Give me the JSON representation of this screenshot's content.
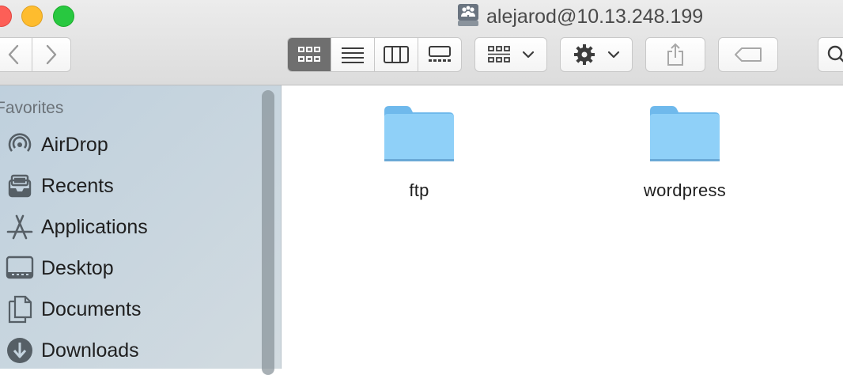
{
  "window": {
    "title": "alejarod@10.13.248.199",
    "title_icon": "network-server-icon"
  },
  "toolbar": {
    "views": [
      {
        "name": "icon-view",
        "active": true
      },
      {
        "name": "list-view",
        "active": false
      },
      {
        "name": "column-view",
        "active": false
      },
      {
        "name": "gallery-view",
        "active": false
      }
    ],
    "buttons": [
      "back",
      "forward",
      "group-by",
      "action",
      "share",
      "tags",
      "search"
    ]
  },
  "sidebar": {
    "heading": "Favorites",
    "items": [
      {
        "label": "AirDrop",
        "icon": "airdrop-icon"
      },
      {
        "label": "Recents",
        "icon": "recents-icon"
      },
      {
        "label": "Applications",
        "icon": "applications-icon"
      },
      {
        "label": "Desktop",
        "icon": "desktop-icon"
      },
      {
        "label": "Documents",
        "icon": "documents-icon"
      },
      {
        "label": "Downloads",
        "icon": "downloads-icon"
      }
    ]
  },
  "files": [
    {
      "name": "ftp",
      "type": "folder"
    },
    {
      "name": "wordpress",
      "type": "folder"
    }
  ],
  "colors": {
    "folder": "#7cc4f2",
    "sidebar": "#c4d3de",
    "active_segment": "#6f6f6f"
  }
}
